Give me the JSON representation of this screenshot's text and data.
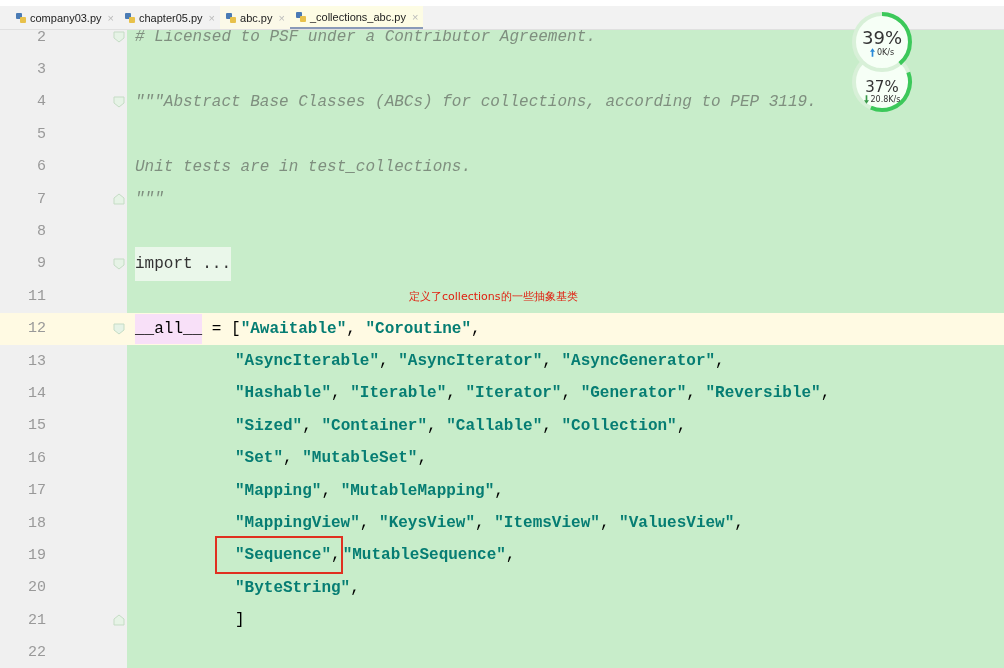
{
  "tabs": [
    {
      "label": "company03.py",
      "close": "×",
      "selected": false
    },
    {
      "label": "chapter05.py",
      "close": "×",
      "selected": false
    },
    {
      "label": "abc.py",
      "close": "×",
      "selected": false
    },
    {
      "label": "_collections_abc.py",
      "close": "×",
      "selected": true
    }
  ],
  "lines": [
    {
      "number": "2",
      "fold_start": true,
      "fold_end": false,
      "current": false,
      "indent": false,
      "segments": [
        {
          "kind": "comment",
          "text": "# Licensed to PSF under a Contributor Agreement."
        }
      ]
    },
    {
      "number": "3",
      "fold_start": false,
      "fold_end": false,
      "current": false
    },
    {
      "number": "4",
      "fold_start": true,
      "fold_end": false,
      "current": false,
      "indent": false,
      "segments": [
        {
          "kind": "doc",
          "text": "\"\"\"Abstract Base Classes (ABCs) for collections, according to PEP 3119."
        }
      ]
    },
    {
      "number": "5",
      "fold_start": false,
      "fold_end": false,
      "current": false
    },
    {
      "number": "6",
      "fold_start": false,
      "fold_end": false,
      "current": false,
      "indent": false,
      "segments": [
        {
          "kind": "doc",
          "text": "Unit tests are in test_collections."
        }
      ]
    },
    {
      "number": "7",
      "fold_start": false,
      "fold_end": true,
      "current": false,
      "indent": false,
      "segments": [
        {
          "kind": "doc",
          "text": "\"\"\""
        }
      ]
    },
    {
      "number": "8",
      "fold_start": false,
      "fold_end": false,
      "current": false
    },
    {
      "number": "9",
      "fold_start": true,
      "fold_end": false,
      "current": false,
      "indent": false,
      "segments": [
        {
          "kind": "folded",
          "text": "import ..."
        }
      ]
    },
    {
      "number": "11",
      "fold_start": false,
      "fold_end": false,
      "current": false,
      "note": "定义了collections的一些抽象基类"
    },
    {
      "number": "12",
      "fold_start": true,
      "fold_end": false,
      "current": true,
      "indent": false,
      "segments": [
        {
          "kind": "dunder",
          "text": "__all__"
        },
        {
          "kind": "plain",
          "text": " = ["
        },
        {
          "kind": "string",
          "text": "\"Awaitable\""
        },
        {
          "kind": "plain",
          "text": ", "
        },
        {
          "kind": "string",
          "text": "\"Coroutine\""
        },
        {
          "kind": "plain",
          "text": ","
        }
      ]
    },
    {
      "number": "13",
      "fold_start": false,
      "fold_end": false,
      "current": false,
      "indent": true,
      "segments": [
        {
          "kind": "string",
          "text": "\"AsyncIterable\""
        },
        {
          "kind": "plain",
          "text": ", "
        },
        {
          "kind": "string",
          "text": "\"AsyncIterator\""
        },
        {
          "kind": "plain",
          "text": ", "
        },
        {
          "kind": "string",
          "text": "\"AsyncGenerator\""
        },
        {
          "kind": "plain",
          "text": ","
        }
      ]
    },
    {
      "number": "14",
      "fold_start": false,
      "fold_end": false,
      "current": false,
      "indent": true,
      "segments": [
        {
          "kind": "string",
          "text": "\"Hashable\""
        },
        {
          "kind": "plain",
          "text": ", "
        },
        {
          "kind": "string",
          "text": "\"Iterable\""
        },
        {
          "kind": "plain",
          "text": ", "
        },
        {
          "kind": "string",
          "text": "\"Iterator\""
        },
        {
          "kind": "plain",
          "text": ", "
        },
        {
          "kind": "string",
          "text": "\"Generator\""
        },
        {
          "kind": "plain",
          "text": ", "
        },
        {
          "kind": "string",
          "text": "\"Reversible\""
        },
        {
          "kind": "plain",
          "text": ","
        }
      ]
    },
    {
      "number": "15",
      "fold_start": false,
      "fold_end": false,
      "current": false,
      "indent": true,
      "segments": [
        {
          "kind": "string",
          "text": "\"Sized\""
        },
        {
          "kind": "plain",
          "text": ", "
        },
        {
          "kind": "string",
          "text": "\"Container\""
        },
        {
          "kind": "plain",
          "text": ", "
        },
        {
          "kind": "string",
          "text": "\"Callable\""
        },
        {
          "kind": "plain",
          "text": ", "
        },
        {
          "kind": "string",
          "text": "\"Collection\""
        },
        {
          "kind": "plain",
          "text": ","
        }
      ]
    },
    {
      "number": "16",
      "fold_start": false,
      "fold_end": false,
      "current": false,
      "indent": true,
      "segments": [
        {
          "kind": "string",
          "text": "\"Set\""
        },
        {
          "kind": "plain",
          "text": ", "
        },
        {
          "kind": "string",
          "text": "\"MutableSet\""
        },
        {
          "kind": "plain",
          "text": ","
        }
      ]
    },
    {
      "number": "17",
      "fold_start": false,
      "fold_end": false,
      "current": false,
      "indent": true,
      "segments": [
        {
          "kind": "string",
          "text": "\"Mapping\""
        },
        {
          "kind": "plain",
          "text": ", "
        },
        {
          "kind": "string",
          "text": "\"MutableMapping\""
        },
        {
          "kind": "plain",
          "text": ","
        }
      ]
    },
    {
      "number": "18",
      "fold_start": false,
      "fold_end": false,
      "current": false,
      "indent": true,
      "segments": [
        {
          "kind": "string",
          "text": "\"MappingView\""
        },
        {
          "kind": "plain",
          "text": ", "
        },
        {
          "kind": "string",
          "text": "\"KeysView\""
        },
        {
          "kind": "plain",
          "text": ", "
        },
        {
          "kind": "string",
          "text": "\"ItemsView\""
        },
        {
          "kind": "plain",
          "text": ", "
        },
        {
          "kind": "string",
          "text": "\"ValuesView\""
        },
        {
          "kind": "plain",
          "text": ","
        }
      ]
    },
    {
      "number": "19",
      "fold_start": false,
      "fold_end": false,
      "current": false,
      "indent": true,
      "segments": [
        {
          "kind": "boxed",
          "parts": [
            {
              "kind": "string",
              "text": "\"Sequence\""
            },
            {
              "kind": "plain",
              "text": ","
            }
          ]
        },
        {
          "kind": "string",
          "text": "\"MutableSequence\""
        },
        {
          "kind": "plain",
          "text": ","
        }
      ]
    },
    {
      "number": "20",
      "fold_start": false,
      "fold_end": false,
      "current": false,
      "indent": true,
      "segments": [
        {
          "kind": "string",
          "text": "\"ByteString\""
        },
        {
          "kind": "plain",
          "text": ","
        }
      ]
    },
    {
      "number": "21",
      "fold_start": false,
      "fold_end": true,
      "current": false,
      "indent": true,
      "segments": [
        {
          "kind": "plain",
          "text": "]"
        }
      ]
    },
    {
      "number": "22",
      "fold_start": false,
      "fold_end": false,
      "current": false
    }
  ],
  "monitor": [
    {
      "kind": "up",
      "percent": "39%",
      "speed": "0K/s",
      "level": 0.39
    },
    {
      "kind": "down",
      "percent": "37%",
      "speed": "20.8K/s",
      "level": 0.37
    }
  ]
}
